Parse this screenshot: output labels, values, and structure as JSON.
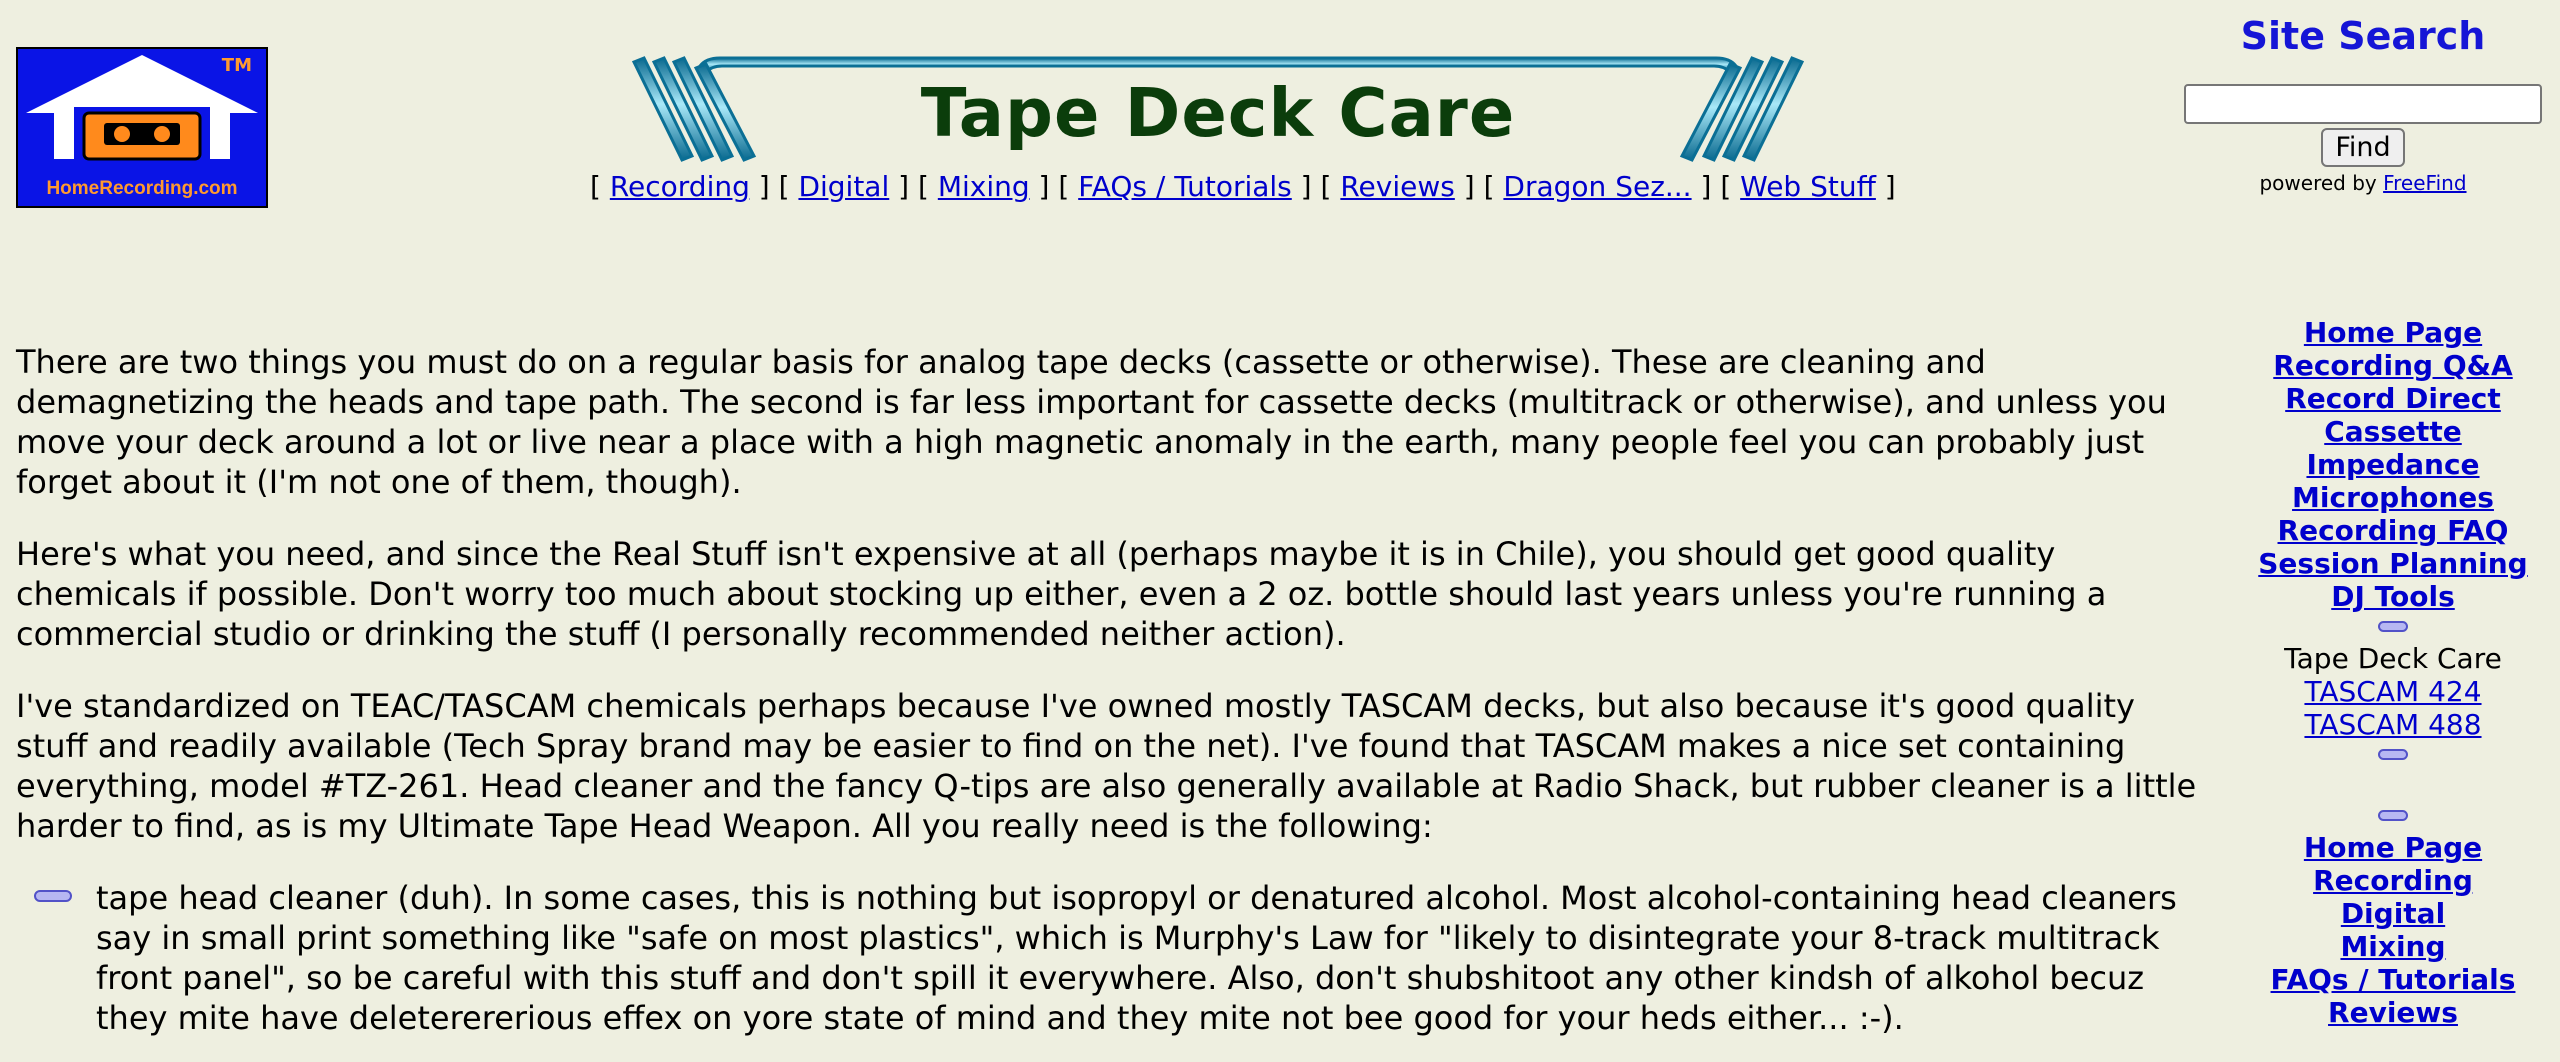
{
  "logo": {
    "tm": "TM",
    "brand": "HomeRecording.com"
  },
  "banner": {
    "title": "Tape Deck Care"
  },
  "topnav": {
    "links": [
      "Recording",
      "Digital",
      "Mixing",
      "FAQs / Tutorials",
      "Reviews",
      "Dragon Sez...",
      "Web Stuff"
    ]
  },
  "search": {
    "title": "Site Search",
    "button": "Find",
    "powered_prefix": "powered by ",
    "powered_link": "FreeFind"
  },
  "content": {
    "p1": "There are two things you must do on a regular basis for analog tape decks (cassette or otherwise). These are cleaning and demagnetizing the heads and tape path. The second is far less important for cassette decks (multitrack or otherwise), and unless you move your deck around a lot or live near a place with a high magnetic anomaly in the earth, many people feel you can probably just forget about it (I'm not one of them, though).",
    "p2": "Here's what you need, and since the Real Stuff isn't expensive at all (perhaps maybe it is in Chile), you should get good quality chemicals if possible. Don't worry too much about stocking up either, even a 2 oz. bottle should last years unless you're running a commercial studio or drinking the stuff (I personally recommended neither action).",
    "p3": "I've standardized on TEAC/TASCAM chemicals perhaps because I've owned mostly TASCAM decks, but also because it's good quality stuff and readily available (Tech Spray brand may be easier to find on the net). I've found that TASCAM makes a nice set containing everything, model #TZ-261. Head cleaner and the fancy Q-tips are also generally available at Radio Shack, but rubber cleaner is a little harder to find, as is my Ultimate Tape Head Weapon. All you really need is the following:",
    "li1": "tape head cleaner (duh). In some cases, this is nothing but isopropyl or denatured alcohol. Most alcohol-containing head cleaners say in small print something like \"safe on most plastics\", which is Murphy's Law for \"likely to disintegrate your 8-track multitrack front panel\", so be careful with this stuff and don't spill it everywhere. Also, don't shubshitoot any other kindsh of alkohol becuz they mite have deleterererious effex on yore state of mind and they mite not bee good for your heds either... :-)."
  },
  "sidebar": {
    "group1": [
      "Home Page",
      "Recording Q&A",
      "Record Direct",
      "Cassette",
      "Impedance",
      "Microphones",
      "Recording FAQ",
      "Session Planning",
      "DJ Tools"
    ],
    "current": "Tape Deck Care",
    "sub": [
      "TASCAM 424",
      "TASCAM 488"
    ],
    "group2": [
      "Home Page",
      "Recording",
      "Digital",
      "Mixing",
      "FAQs / Tutorials",
      "Reviews"
    ]
  },
  "colors": {
    "background": "#eeefe0",
    "link": "#0000cc",
    "title_green": "#0b3d0b",
    "search_title": "#1515d6",
    "logo_blue": "#0a14e6",
    "logo_orange": "#ff9a2e"
  }
}
